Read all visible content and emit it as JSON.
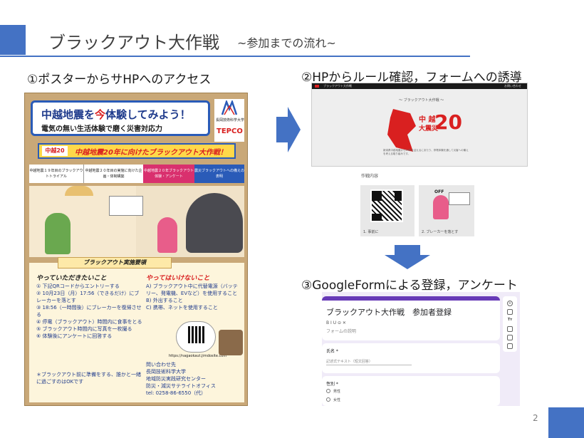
{
  "slide": {
    "title": "ブラックアウト大作戦",
    "subtitle": "~参加までの流れ~",
    "page_number": "2"
  },
  "steps": {
    "step1": "①ポスターからサHPへのアクセス",
    "step2": "②HPからルール確認，フォームへの誘導",
    "step3": "③GoogleFormによる登録，アンケート"
  },
  "poster": {
    "headline_prefix": "中越地震を",
    "headline_highlight": "今",
    "headline_suffix": "体験してみよう！",
    "tagline": "電気の無い生活体験で磨く災害対応力",
    "logo_university": "長岡技術科学大学",
    "logo_tepco": "TEPCO",
    "badge": "中越20",
    "yellow_banner": "中越地震20年に向けたブラックアウト大作戦！",
    "flow": [
      "中越地震１９年目のブラックアウトトライアル",
      "中越地震２０年目の実施に向けた企画・体制構築",
      "中越地震２０年ブラックアウト体験・アンケート",
      "震災ブラックアウトへの備えの表明"
    ],
    "notes_tag": "ブラックアウト実施要領",
    "do_heading": "やっていただきたいこと",
    "do_items": [
      "① 下記QRコードからエントリーする",
      "② 10月23日（月）17:56（できるだけ）にブレーカーを落とす",
      "③ 18:56（一時間後）にブレーカーを復帰させる",
      "④ 停電（ブラックアウト）時間内に食事をとる",
      "⑤ ブラックアウト時間内に写真を一枚撮る",
      "⑥ 体験後にアンケートに回答する"
    ],
    "dont_heading": "やってはいけないこと",
    "dont_items": [
      "A) ブラックアウト中に代替電源（バッテリー、発電機、EVなど）を使用すること",
      "B) 外出すること",
      "C) 携帯、ネットを使用すること"
    ],
    "qr_url": "https://nagaokaut.jimdosite.com",
    "footnote": "＊ブラックアウト前に準備をする、誰かと一緒に過ごすのはOKです",
    "contact": [
      "問い合わせ先",
      "長岡技術科学大学",
      "地域防災実践研究センター",
      "防災・減災サテライトオフィス",
      "tel: 0258-86-6550（代）"
    ]
  },
  "website": {
    "topbar_left": "ブラックアウト大作戦",
    "topbar_right": "お問い合わせ",
    "hero_label": "～ ブラックアウト大作戦 ～",
    "logo_top": "中 越",
    "logo_bottom": "大震災",
    "logo_number": "20",
    "body_text": "新潟県中越地震から20年を迎えるにあたり、停電体験を通して災害への備えを考える取り組みです。",
    "section_label": "作戦内容",
    "card1_caption": "1. 事前に",
    "card2_caption": "2. ブレーカーを落とす",
    "card2_badge": "OFF"
  },
  "google_form": {
    "form_title": "ブラックアウト大作戦　参加者登録",
    "toolbar": "B  I  U  ⊝  ✕",
    "description_placeholder": "フォームの説明",
    "q1_label": "氏名 *",
    "q1_placeholder": "記述式テキスト（短文回答）",
    "q2_label": "性別 *",
    "q2_options": [
      "男性",
      "女性"
    ]
  },
  "colors": {
    "accent": "#4472c4",
    "form_purple": "#673ab7",
    "poster_red": "#d92020"
  }
}
